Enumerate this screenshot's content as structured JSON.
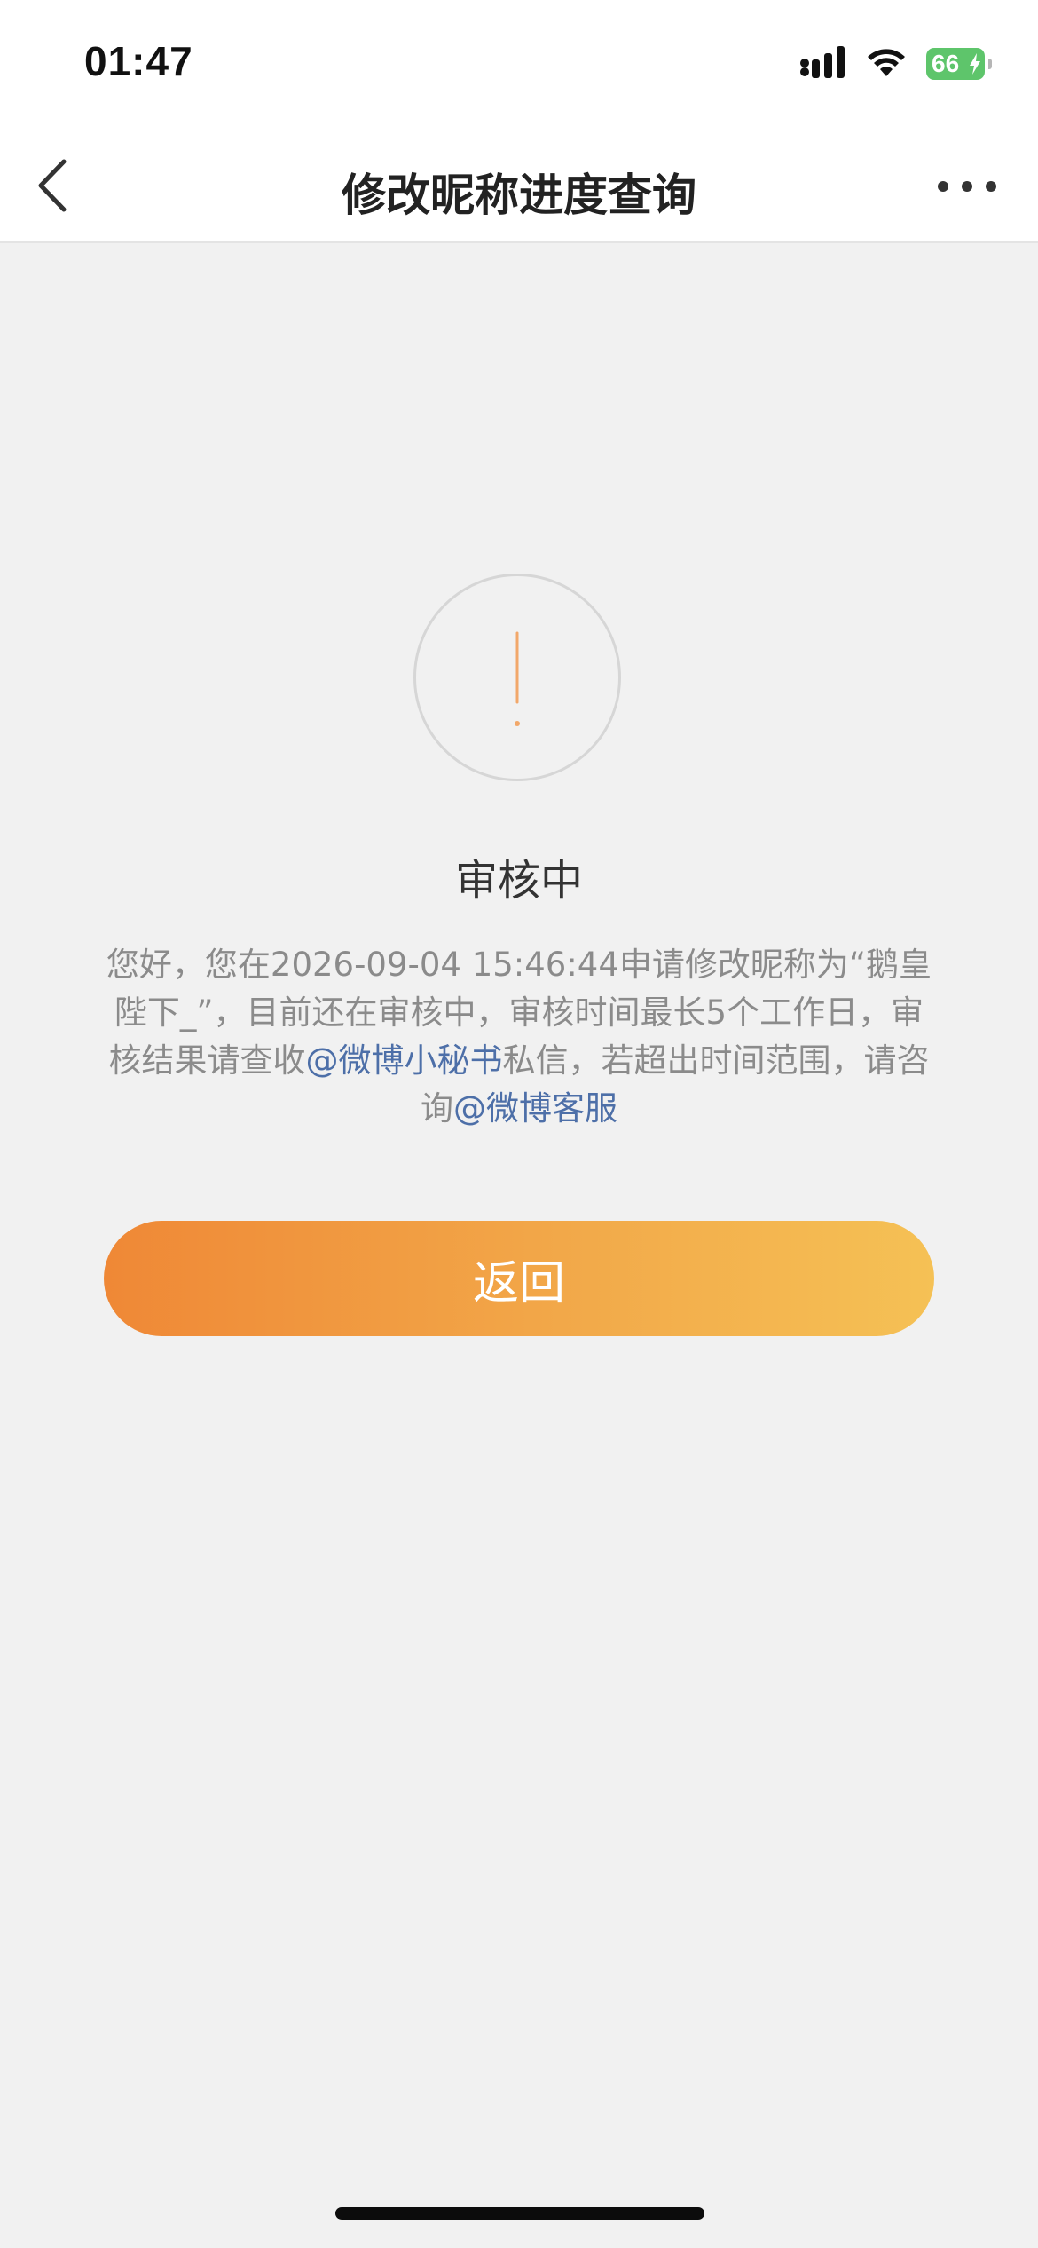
{
  "status_bar": {
    "time": "01:47",
    "battery_level": "66",
    "icons": [
      "cellular-signal-icon",
      "wifi-icon",
      "battery-charging-icon"
    ]
  },
  "nav": {
    "title": "修改昵称进度查询",
    "back_icon": "chevron-left-icon",
    "more_icon": "more-dots-icon"
  },
  "review": {
    "icon": "exclamation-circle-icon",
    "status_title": "审核中",
    "message_part1": "您好，您在2026-09-04 15:46:44申请修改昵称为“鹅皇陛下_”，目前还在审核中，审核时间最长5个工作日，审核结果请查收",
    "link_secretary": "@微博小秘书",
    "message_part2": "私信，若超出时间范围，请咨询",
    "link_service": "@微博客服"
  },
  "actions": {
    "return_label": "返回"
  },
  "colors": {
    "accent_start": "#ef8836",
    "accent_end": "#f5c155",
    "link": "#4d6fa8",
    "icon_orange": "#f2a86a",
    "background": "#f1f1f1"
  }
}
